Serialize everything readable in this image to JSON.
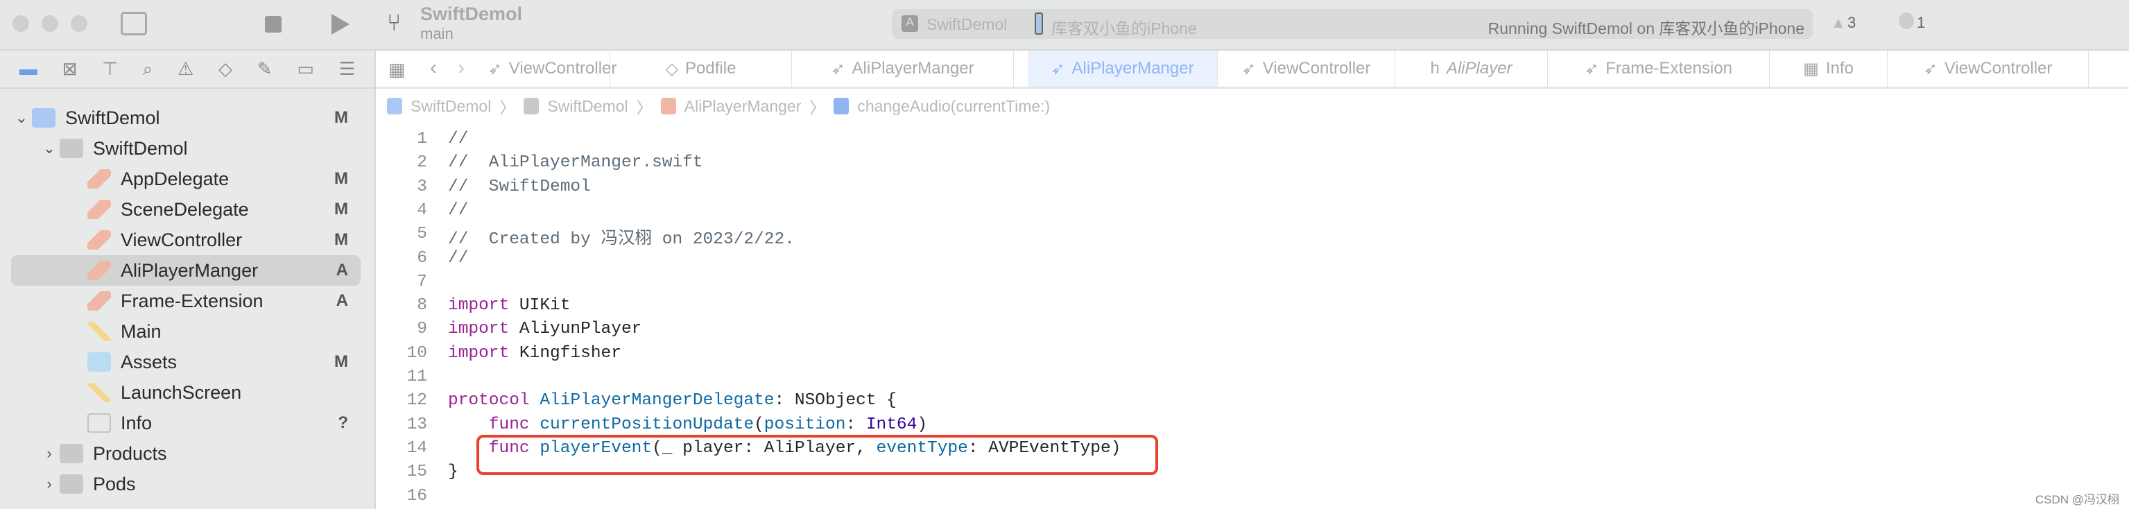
{
  "toolbar": {
    "project": "SwiftDemol",
    "branch": "main",
    "scheme": "SwiftDemol",
    "device": "库客双小鱼的iPhone",
    "status": "Running SwiftDemol on 库客双小鱼的iPhone",
    "warnings": "3",
    "errors": "1"
  },
  "navigator_icons": [
    "folder-icon",
    "source-control-icon",
    "hierarchy-icon",
    "search-icon",
    "warning-icon",
    "test-icon",
    "debug-icon",
    "breakpoint-icon",
    "report-icon"
  ],
  "sidebar": {
    "items": [
      {
        "label": "SwiftDemol",
        "badge": "M",
        "depth": 0,
        "chevron": "⌄",
        "icon": "app-project"
      },
      {
        "label": "SwiftDemol",
        "badge": "",
        "depth": 1,
        "chevron": "⌄",
        "icon": "folder"
      },
      {
        "label": "AppDelegate",
        "badge": "M",
        "depth": 2,
        "icon": "swift"
      },
      {
        "label": "SceneDelegate",
        "badge": "M",
        "depth": 2,
        "icon": "swift"
      },
      {
        "label": "ViewController",
        "badge": "M",
        "depth": 2,
        "icon": "swift"
      },
      {
        "label": "AliPlayerManger",
        "badge": "A",
        "depth": 2,
        "icon": "swift",
        "selected": true
      },
      {
        "label": "Frame-Extension",
        "badge": "A",
        "depth": 2,
        "icon": "swift"
      },
      {
        "label": "Main",
        "badge": "",
        "depth": 2,
        "icon": "storyboard"
      },
      {
        "label": "Assets",
        "badge": "M",
        "depth": 2,
        "icon": "assets"
      },
      {
        "label": "LaunchScreen",
        "badge": "",
        "depth": 2,
        "icon": "storyboard"
      },
      {
        "label": "Info",
        "badge": "?",
        "depth": 2,
        "icon": "plist"
      },
      {
        "label": "Products",
        "badge": "",
        "depth": 1,
        "chevron": "›",
        "icon": "folder"
      },
      {
        "label": "Pods",
        "badge": "",
        "depth": 1,
        "chevron": "›",
        "icon": "folder"
      }
    ]
  },
  "tabs": [
    {
      "label": "ViewController",
      "icon": "swift"
    },
    {
      "label": "Podfile",
      "icon": "ruby"
    },
    {
      "label": "AliPlayerManger",
      "icon": "swift"
    },
    {
      "label": "AliPlayerManger",
      "icon": "swift",
      "active": true
    },
    {
      "label": "ViewController",
      "icon": "swift"
    },
    {
      "label": "AliPlayer",
      "icon": "header"
    },
    {
      "label": "Frame-Extension",
      "icon": "swift"
    },
    {
      "label": "Info",
      "icon": "plist"
    },
    {
      "label": "ViewController",
      "icon": "swift"
    }
  ],
  "breadcrumb": [
    "SwiftDemol",
    "SwiftDemol",
    "AliPlayerManger",
    "changeAudio(currentTime:)"
  ],
  "code": [
    [
      [
        "//",
        "cm"
      ]
    ],
    [
      [
        "//  AliPlayerManger.swift",
        "cm"
      ]
    ],
    [
      [
        "//  SwiftDemol",
        "cm"
      ]
    ],
    [
      [
        "//",
        "cm"
      ]
    ],
    [
      [
        "//  Created by 冯汉栩 on 2023/2/22.",
        "cm"
      ]
    ],
    [
      [
        "//",
        "cm"
      ]
    ],
    [],
    [
      [
        "import",
        "kw"
      ],
      [
        " UIKit",
        "pl"
      ]
    ],
    [
      [
        "import",
        "kw"
      ],
      [
        " AliyunPlayer",
        "pl"
      ]
    ],
    [
      [
        "import",
        "kw"
      ],
      [
        " Kingfisher",
        "pl"
      ]
    ],
    [],
    [
      [
        "protocol",
        "kw"
      ],
      [
        " ",
        "pl"
      ],
      [
        "AliPlayerMangerDelegate",
        "nm"
      ],
      [
        ": NSObject {",
        "pl"
      ]
    ],
    [
      [
        "    ",
        "pl"
      ],
      [
        "func",
        "kw"
      ],
      [
        " ",
        "pl"
      ],
      [
        "currentPositionUpdate",
        "nm"
      ],
      [
        "(",
        "pl"
      ],
      [
        "position",
        "nm"
      ],
      [
        ": ",
        "pl"
      ],
      [
        "Int64",
        "ty"
      ],
      [
        ")",
        "pl"
      ]
    ],
    [
      [
        "    ",
        "pl"
      ],
      [
        "func",
        "kw"
      ],
      [
        " ",
        "pl"
      ],
      [
        "playerEvent",
        "nm"
      ],
      [
        "(_ player: AliPlayer, ",
        "pl"
      ],
      [
        "eventType",
        "nm"
      ],
      [
        ": AVPEventType)",
        "pl"
      ]
    ],
    [
      [
        "}",
        "pl"
      ]
    ],
    []
  ],
  "watermark": "CSDN @冯汉栩",
  "colors": {
    "highlight_box": "#e8412c",
    "keyword": "#9b2393",
    "comment": "#5d6c79",
    "active_tab": "#e9f2fe"
  }
}
